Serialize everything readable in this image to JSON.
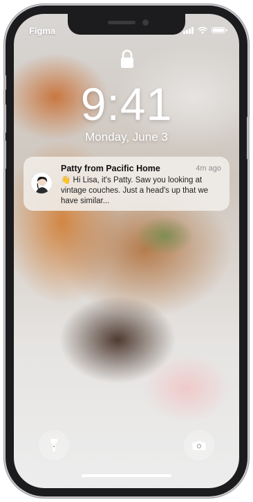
{
  "status_bar": {
    "carrier": "Figma",
    "icons": [
      "signal-icon",
      "wifi-icon",
      "battery-icon"
    ]
  },
  "lock_screen": {
    "lock_icon": "lock-icon",
    "time": "9:41",
    "date": "Monday, June 3"
  },
  "notification": {
    "title": "Patty from Pacific Home",
    "timestamp": "4m ago",
    "body": "👋 Hi Lisa, it's Patty. Saw you looking at vintage couches. Just a head's up that we have similar...",
    "avatar": "avatar"
  },
  "quick_actions": {
    "left_icon": "flashlight-icon",
    "right_icon": "camera-icon"
  },
  "colors": {
    "frame": "#1c1c1e",
    "text_light": "#ffffff",
    "notification_bg": "#f0ece8"
  }
}
